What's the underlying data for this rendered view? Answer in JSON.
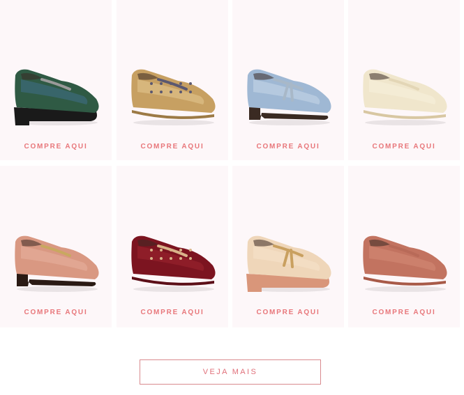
{
  "products": [
    {
      "cta": "COMPRE AQUI",
      "icon": "green-croc-chain-loafer-image",
      "colors": {
        "upper": "#2f5a44",
        "upper2": "#3f6f8a",
        "sole": "#1a1a1a",
        "accent": "#9a9a9a"
      }
    },
    {
      "cta": "COMPRE AQUI",
      "icon": "gold-embellished-slipper-image",
      "colors": {
        "upper": "#c7a062",
        "upper2": "#e4c891",
        "sole": "#9c7a45",
        "accent": "#5b5870"
      }
    },
    {
      "cta": "COMPRE AQUI",
      "icon": "blue-snake-tassel-loafer-image",
      "colors": {
        "upper": "#9fb8d4",
        "upper2": "#c7d7e8",
        "sole": "#3a2a22",
        "accent": "#a8b8c8"
      }
    },
    {
      "cta": "COMPRE AQUI",
      "icon": "cream-penny-loafer-image",
      "colors": {
        "upper": "#f0e6cc",
        "upper2": "#f7f0dc",
        "sole": "#d8c7a2",
        "accent": "#e3d6b6"
      }
    },
    {
      "cta": "COMPRE AQUI",
      "icon": "pink-horsebit-loafer-image",
      "colors": {
        "upper": "#d99882",
        "upper2": "#e8b3a0",
        "sole": "#2a1a14",
        "accent": "#c9a860"
      }
    },
    {
      "cta": "COMPRE AQUI",
      "icon": "burgundy-studded-slipper-image",
      "colors": {
        "upper": "#7c1420",
        "upper2": "#9c2430",
        "sole": "#5c0f18",
        "accent": "#d9b48a"
      }
    },
    {
      "cta": "COMPRE AQUI",
      "icon": "beige-platform-tassel-loafer-image",
      "colors": {
        "upper": "#efd6b9",
        "upper2": "#f6e3cc",
        "sole": "#d9967a",
        "accent": "#c9a060"
      }
    },
    {
      "cta": "COMPRE AQUI",
      "icon": "terracotta-croc-loafer-image",
      "colors": {
        "upper": "#c27360",
        "upper2": "#d58a76",
        "sole": "#a85a48",
        "accent": "#b86a58"
      }
    }
  ],
  "more_button": {
    "label": "VEJA MAIS"
  },
  "colors": {
    "card_bg": "#fdf7f9",
    "cta": "#e8777b",
    "button_border": "#d98a8e"
  }
}
